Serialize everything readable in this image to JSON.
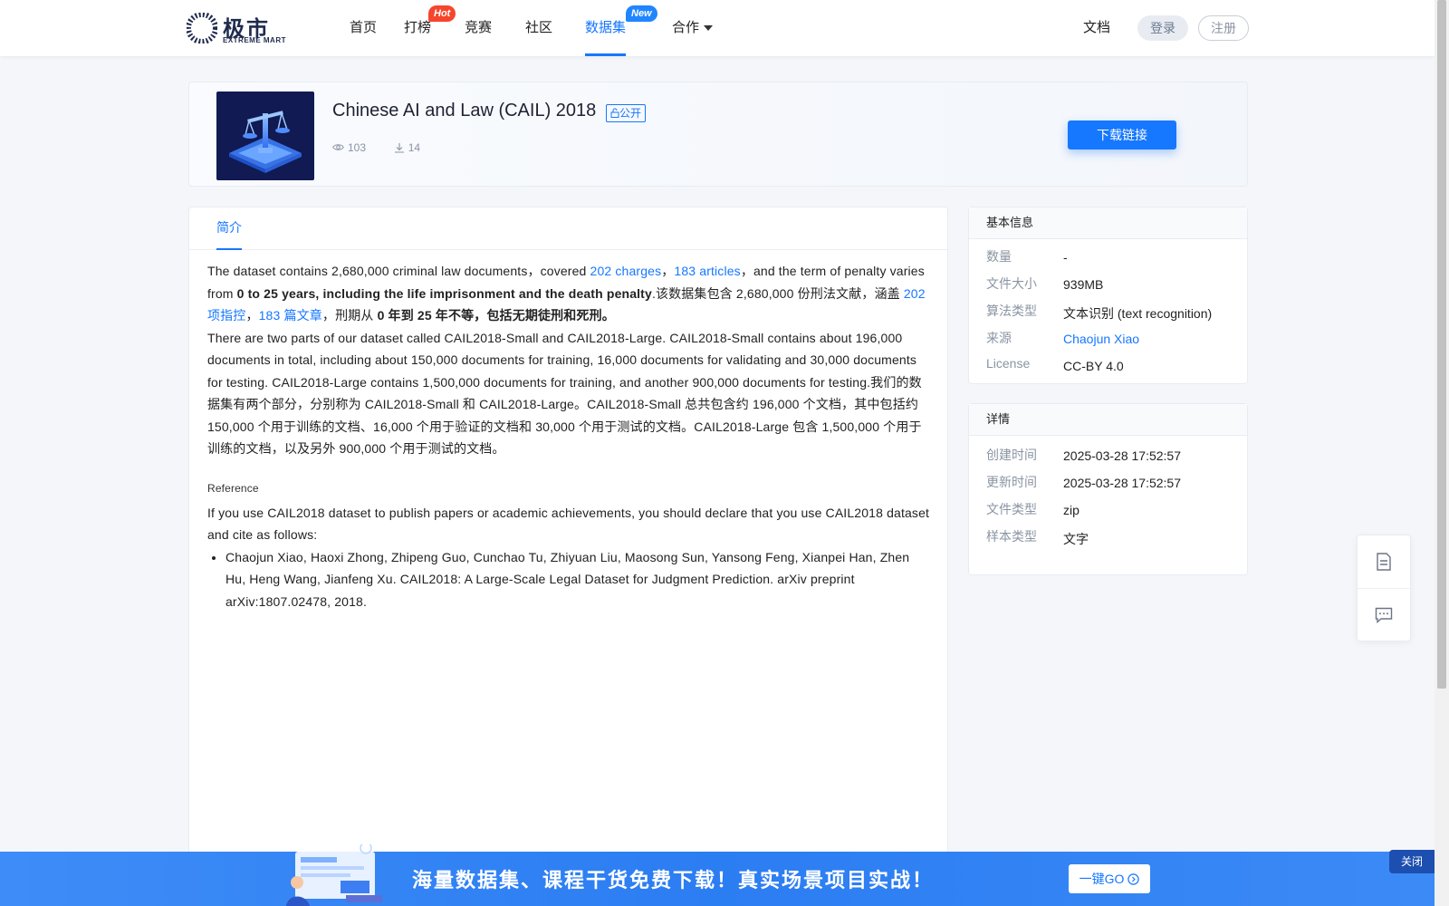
{
  "nav": {
    "logo_cn": "极市",
    "logo_en": "EXTREME MART",
    "items": [
      {
        "label": "首页"
      },
      {
        "label": "打榜",
        "badge": "Hot"
      },
      {
        "label": "竞赛"
      },
      {
        "label": "社区"
      },
      {
        "label": "数据集",
        "badge": "New",
        "active": true
      },
      {
        "label": "合作"
      }
    ],
    "docs": "文档",
    "login": "登录",
    "register": "注册"
  },
  "dataset": {
    "title": "Chinese AI and Law (CAIL) 2018",
    "visibility": "公开",
    "views": "103",
    "downloads": "14",
    "download_button": "下载链接"
  },
  "tabs": {
    "intro": "简介"
  },
  "description": {
    "p1_a": "The dataset contains 2,680,000 criminal law documents，covered ",
    "p1_link1": "202 charges",
    "p1_sep1": "，",
    "p1_link2": "183 articles",
    "p1_b": "，and the term of penalty varies from ",
    "p1_bold": "0 to 25 years, including the life imprisonment and the death penalty",
    "p1_c": ".该数据集包含 2,680,000 份刑法文献，涵盖 ",
    "p1_link3": "202 项指控",
    "p1_sep2": "，",
    "p1_link4": "183 篇文章",
    "p1_d": "，刑期从 ",
    "p1_bold2": "0 年到 25 年不等，包括无期徒刑和死刑。",
    "p2": "There are two parts of our dataset called CAIL2018-Small and CAIL2018-Large. CAIL2018-Small contains about 196,000 documents in total, including about 150,000 documents for training, 16,000 documents for validating and 30,000 documents for testing. CAIL2018-Large contains 1,500,000 documents for training, and another 900,000 documents for testing.我们的数据集有两个部分，分别称为 CAIL2018-Small 和 CAIL2018-Large。CAIL2018-Small 总共包含约 196,000 个文档，其中包括约 150,000 个用于训练的文档、16,000 个用于验证的文档和 30,000 个用于测试的文档。CAIL2018-Large 包含 1,500,000 个用于训练的文档，以及另外 900,000 个用于测试的文档。",
    "reference_title": "Reference",
    "reference_text": "If you use CAIL2018 dataset to publish papers or academic achievements, you should declare that you use CAIL2018 dataset and cite as follows:",
    "citation": "Chaojun Xiao, Haoxi Zhong, Zhipeng Guo, Cunchao Tu, Zhiyuan Liu, Maosong Sun, Yansong Feng, Xianpei Han, Zhen Hu, Heng Wang, Jianfeng Xu. CAIL2018: A Large-Scale Legal Dataset for Judgment Prediction. arXiv preprint arXiv:1807.02478, 2018."
  },
  "basic_info": {
    "title": "基本信息",
    "rows": [
      {
        "key": "数量",
        "value": "-"
      },
      {
        "key": "文件大小",
        "value": "939MB"
      },
      {
        "key": "算法类型",
        "value": "文本识别 (text recognition)"
      },
      {
        "key": "来源",
        "value": "Chaojun Xiao"
      },
      {
        "key": "License",
        "value": "CC-BY 4.0"
      }
    ]
  },
  "details": {
    "title": "详情",
    "rows": [
      {
        "key": "创建时间",
        "value": "2025-03-28 17:52:57"
      },
      {
        "key": "更新时间",
        "value": "2025-03-28 17:52:57"
      },
      {
        "key": "文件类型",
        "value": "zip"
      },
      {
        "key": "样本类型",
        "value": "文字"
      }
    ]
  },
  "banner": {
    "text": "海量数据集、课程干货免费下载！真实场景项目实战！",
    "go": "一键GO",
    "close": "关闭"
  },
  "colors": {
    "accent": "#1677ff",
    "hot": "#f5462d",
    "new": "#1f86ff"
  }
}
